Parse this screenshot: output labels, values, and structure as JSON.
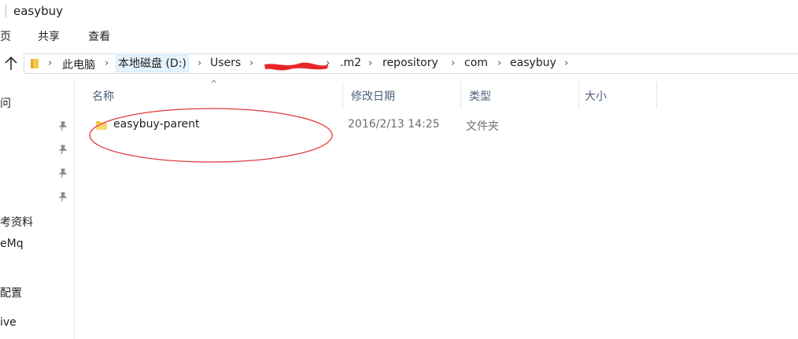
{
  "window": {
    "title": "easybuy"
  },
  "ribbon": {
    "tabs": [
      "页",
      "共享",
      "查看"
    ]
  },
  "address": {
    "crumbs": [
      "此电脑",
      "本地磁盘 (D:)",
      "Users",
      ".m2",
      "repository",
      "com",
      "easybuy"
    ]
  },
  "left_pane": {
    "items": [
      "问",
      "考资料",
      "eMq",
      "配置",
      "ive"
    ]
  },
  "columns": {
    "name": "名称",
    "date": "修改日期",
    "type": "类型",
    "size": "大小"
  },
  "files": [
    {
      "name": "easybuy-parent",
      "date": "2016/2/13 14:25",
      "type": "文件夹"
    }
  ],
  "colors": {
    "folder": "#f6c745",
    "annotation": "#e23b3b",
    "header_text": "#4c607a",
    "highlight": "#e5f3ff"
  }
}
